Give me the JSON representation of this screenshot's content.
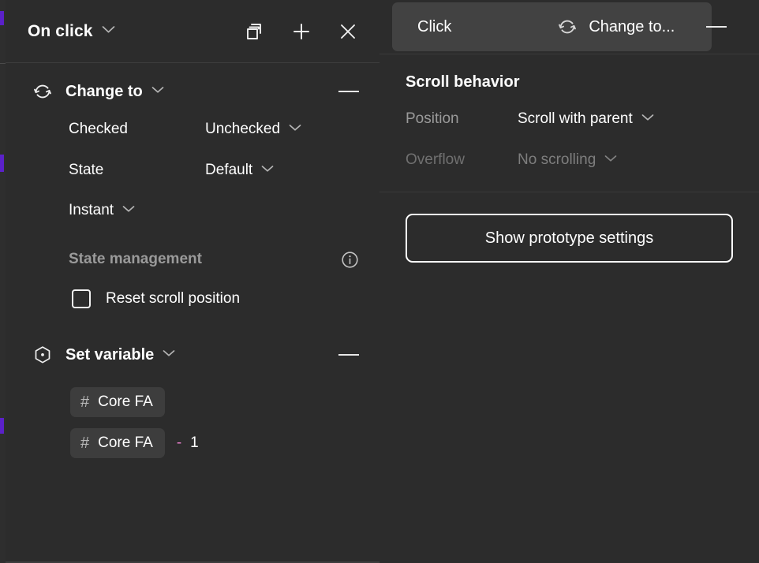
{
  "colors": {
    "panel_bg": "#2c2c2c",
    "chip_bg": "#3d3d3d",
    "selected_row_bg": "#424242",
    "accent_purple": "#5b21c9",
    "operator_pink": "#e87ecb",
    "text_primary": "#ffffff",
    "text_muted": "#9a9a9a",
    "text_disabled": "#7e7e7e"
  },
  "left_panel": {
    "header": {
      "title": "On click",
      "dropdown_icon": "chevron-down-icon",
      "actions": [
        {
          "icon": "duplicate-icon",
          "label": "Duplicate"
        },
        {
          "icon": "plus-icon",
          "label": "Add"
        },
        {
          "icon": "close-icon",
          "label": "Close"
        }
      ]
    },
    "sections": [
      {
        "id": "change-to",
        "icon": "swap-instance-icon",
        "title": "Change to",
        "dropdown_icon": "chevron-down-icon",
        "collapse_icon": "minus-icon",
        "properties": [
          {
            "label": "Checked",
            "value": "Unchecked",
            "dropdown_icon": "chevron-down-icon",
            "disabled": false
          },
          {
            "label": "State",
            "value": "Default",
            "dropdown_icon": "chevron-down-icon",
            "disabled": false
          }
        ],
        "animation": {
          "value": "Instant",
          "dropdown_icon": "chevron-down-icon"
        },
        "state_management": {
          "title": "State management",
          "info_icon": "info-icon",
          "checkbox": {
            "label": "Reset scroll position",
            "checked": false
          }
        }
      },
      {
        "id": "set-variable",
        "icon": "variable-hexagon-icon",
        "title": "Set variable",
        "dropdown_icon": "chevron-down-icon",
        "collapse_icon": "minus-icon",
        "variables": [
          {
            "hash": "#",
            "name": "Core FA",
            "operator": "",
            "operand": ""
          },
          {
            "hash": "#",
            "name": "Core FA",
            "operator": "-",
            "operand": "1"
          }
        ]
      }
    ]
  },
  "right_panel": {
    "interaction_row": {
      "trigger": "Click",
      "action_icon": "swap-instance-icon",
      "action": "Change to...",
      "collapse_icon": "minus-icon"
    },
    "scroll_behavior": {
      "title": "Scroll behavior",
      "properties": [
        {
          "label": "Position",
          "value": "Scroll with parent",
          "dropdown_icon": "chevron-down-icon",
          "disabled": false
        },
        {
          "label": "Overflow",
          "value": "No scrolling",
          "dropdown_icon": "chevron-down-icon",
          "disabled": true
        }
      ]
    },
    "prototype_button": {
      "label": "Show prototype settings"
    }
  }
}
